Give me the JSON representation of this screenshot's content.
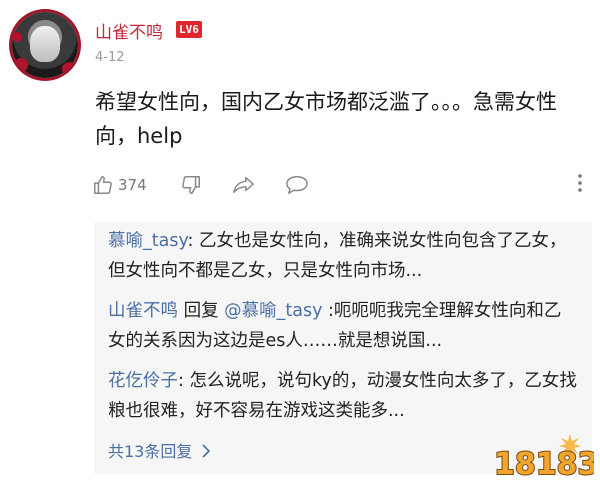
{
  "comment": {
    "username": "山雀不鸣",
    "level": "LV6",
    "date": "4-12",
    "text": "希望女性向，国内乙女市场都泛滥了。。。急需女性向，help",
    "like_count": "374"
  },
  "icons": {
    "like": "thumbs-up-icon",
    "dislike": "thumbs-down-icon",
    "share": "share-icon",
    "reply": "comment-bubble-icon",
    "more": "more-vertical-icon"
  },
  "replies": [
    {
      "user": "慕喻_tasy",
      "sep": ": ",
      "text": "乙女也是女性向，准确来说女性向包含了乙女，但女性向不都是乙女，只是女性向市场..."
    },
    {
      "user": "山雀不鸣",
      "mid": " 回复 ",
      "target": "@慕喻_tasy",
      "sep": " :",
      "text": "呃呃呃我完全理解女性向和乙女的关系因为这边是es人……就是想说国..."
    },
    {
      "user": "花仡伶子",
      "sep": ": ",
      "text": "怎么说呢，说句ky的，动漫女性向太多了，乙女找粮也很难，好不容易在游戏这类能多..."
    }
  ],
  "total_replies": "共13条回复",
  "watermark_text": "18183",
  "colors": {
    "username": "#c4293a",
    "badge": "#e2262f",
    "reply_user": "#4a6fa5",
    "reply_bg": "#f6f6f6"
  }
}
